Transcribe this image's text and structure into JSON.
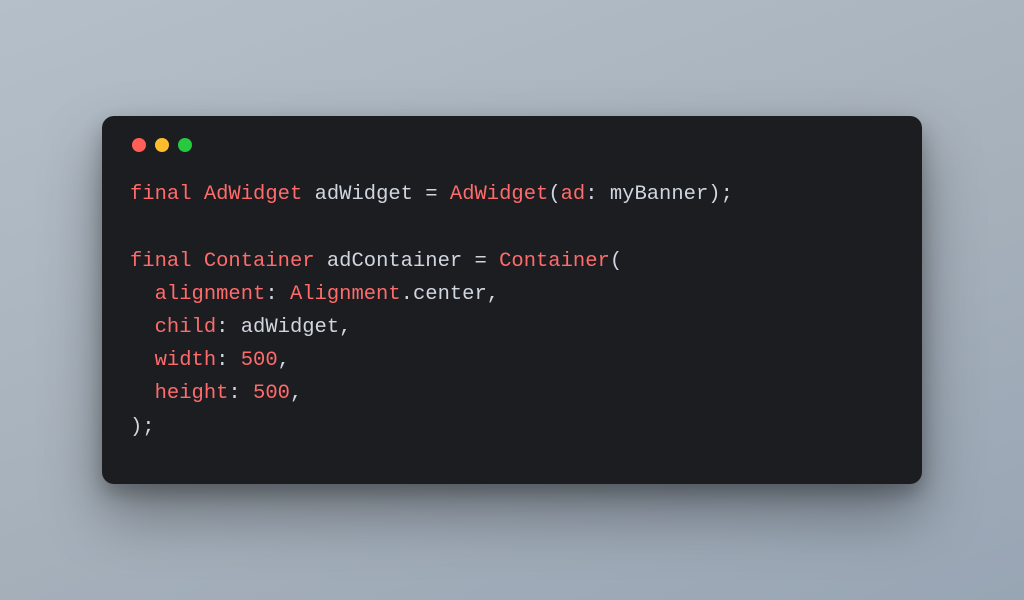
{
  "window": {
    "traffic_lights": [
      "close",
      "minimize",
      "zoom"
    ]
  },
  "code": {
    "lines": [
      [
        {
          "cls": "tok-keyword",
          "t": "final"
        },
        {
          "cls": "tok-punct",
          "t": " "
        },
        {
          "cls": "tok-type",
          "t": "AdWidget"
        },
        {
          "cls": "tok-punct",
          "t": " "
        },
        {
          "cls": "tok-ident",
          "t": "adWidget"
        },
        {
          "cls": "tok-punct",
          "t": " = "
        },
        {
          "cls": "tok-type",
          "t": "AdWidget"
        },
        {
          "cls": "tok-punct",
          "t": "("
        },
        {
          "cls": "tok-param",
          "t": "ad"
        },
        {
          "cls": "tok-punct",
          "t": ": "
        },
        {
          "cls": "tok-ident",
          "t": "myBanner"
        },
        {
          "cls": "tok-punct",
          "t": ");"
        }
      ],
      [],
      [
        {
          "cls": "tok-keyword",
          "t": "final"
        },
        {
          "cls": "tok-punct",
          "t": " "
        },
        {
          "cls": "tok-type",
          "t": "Container"
        },
        {
          "cls": "tok-punct",
          "t": " "
        },
        {
          "cls": "tok-ident",
          "t": "adContainer"
        },
        {
          "cls": "tok-punct",
          "t": " = "
        },
        {
          "cls": "tok-type",
          "t": "Container"
        },
        {
          "cls": "tok-punct",
          "t": "("
        }
      ],
      [
        {
          "cls": "tok-punct",
          "t": "  "
        },
        {
          "cls": "tok-param",
          "t": "alignment"
        },
        {
          "cls": "tok-punct",
          "t": ": "
        },
        {
          "cls": "tok-type",
          "t": "Alignment"
        },
        {
          "cls": "tok-punct",
          "t": "."
        },
        {
          "cls": "tok-ident",
          "t": "center"
        },
        {
          "cls": "tok-punct",
          "t": ","
        }
      ],
      [
        {
          "cls": "tok-punct",
          "t": "  "
        },
        {
          "cls": "tok-param",
          "t": "child"
        },
        {
          "cls": "tok-punct",
          "t": ": "
        },
        {
          "cls": "tok-ident",
          "t": "adWidget"
        },
        {
          "cls": "tok-punct",
          "t": ","
        }
      ],
      [
        {
          "cls": "tok-punct",
          "t": "  "
        },
        {
          "cls": "tok-param",
          "t": "width"
        },
        {
          "cls": "tok-punct",
          "t": ": "
        },
        {
          "cls": "tok-number",
          "t": "500"
        },
        {
          "cls": "tok-punct",
          "t": ","
        }
      ],
      [
        {
          "cls": "tok-punct",
          "t": "  "
        },
        {
          "cls": "tok-param",
          "t": "height"
        },
        {
          "cls": "tok-punct",
          "t": ": "
        },
        {
          "cls": "tok-number",
          "t": "500"
        },
        {
          "cls": "tok-punct",
          "t": ","
        }
      ],
      [
        {
          "cls": "tok-punct",
          "t": ");"
        }
      ]
    ]
  }
}
